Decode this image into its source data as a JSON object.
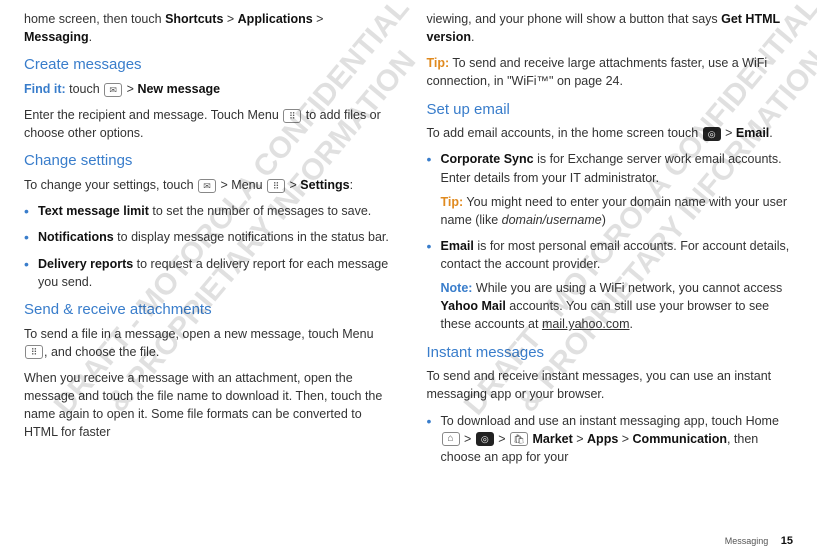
{
  "col1": {
    "intro_pre": "home screen, then touch ",
    "intro_b1": "Shortcuts",
    "sep": " > ",
    "intro_b2": "Applications",
    "intro_b3": "Messaging",
    "intro_end": ".",
    "h_create": "Create messages",
    "findit": "Find it:",
    "findit_text1": " touch ",
    "findit_b": "New message",
    "create_body": "Enter the recipient and message. Touch Menu ",
    "create_body2": " to add files or choose other options.",
    "h_change": "Change settings",
    "change_intro1": "To change your settings, touch ",
    "change_intro2": " > Menu ",
    "change_intro3": " > ",
    "change_b": "Settings",
    "bullets": [
      {
        "b": "Text message limit",
        "t": " to set the number of messages to save."
      },
      {
        "b": "Notifications",
        "t": " to display message notifications in the status bar."
      },
      {
        "b": "Delivery reports",
        "t": " to request a delivery report for each message you send."
      }
    ],
    "h_send": "Send & receive attachments",
    "send_p1a": "To send a file in a message, open a new message, touch Menu ",
    "send_p1b": ", and choose the file.",
    "send_p2": "When you receive a message with an attachment, open the message and touch the file name to download it. Then, touch the name again to open it. Some file formats can be converted to HTML for faster"
  },
  "col2": {
    "top1a": "viewing, and your phone will show a button that says ",
    "top1b": "Get HTML version",
    "tip_lbl": "Tip:",
    "tip_body": " To send and receive large attachments faster, use a WiFi connection, in \"WiFi™\" on page 24.",
    "h_setup": "Set up email",
    "setup_p1a": "To add email accounts, in the home screen touch ",
    "setup_p1b": " > ",
    "setup_b": "Email",
    "corp_b": "Corporate Sync",
    "corp_t": " is for Exchange server work email accounts. Enter details from your IT administrator.",
    "corp_tip": " You might need to enter your domain name with your user name (like ",
    "corp_tip_i": "domain/username",
    "corp_tip_end": ")",
    "email_b": "Email",
    "email_t": " is for most personal email accounts. For account details, contact the account provider.",
    "note_lbl": "Note:",
    "note_body1": " While you are using a WiFi network, you cannot access ",
    "note_b": "Yahoo Mail",
    "note_body2": " accounts. You can still use your browser to see these accounts at ",
    "note_link": "mail.yahoo.com",
    "h_im": "Instant messages",
    "im_intro": "To send and receive instant messages, you can use an instant messaging app or your browser.",
    "im_li1a": "To download and use an instant messaging app, touch Home ",
    "im_li1_market": "Market",
    "im_li1_apps": "Apps",
    "im_li1_comm": "Communication",
    "im_li1b": ", then choose an app for your"
  },
  "icons": {
    "msg": "✉",
    "menu": "⠿",
    "circle": "◎",
    "home": "⌂",
    "bag": "🛍"
  },
  "footer": {
    "section": "Messaging",
    "page": "15"
  },
  "watermarks": {
    "line1": "DRAFT - MOTOROLA CONFIDENTIAL",
    "line2": "& PROPRIETARY INFORMATION"
  }
}
